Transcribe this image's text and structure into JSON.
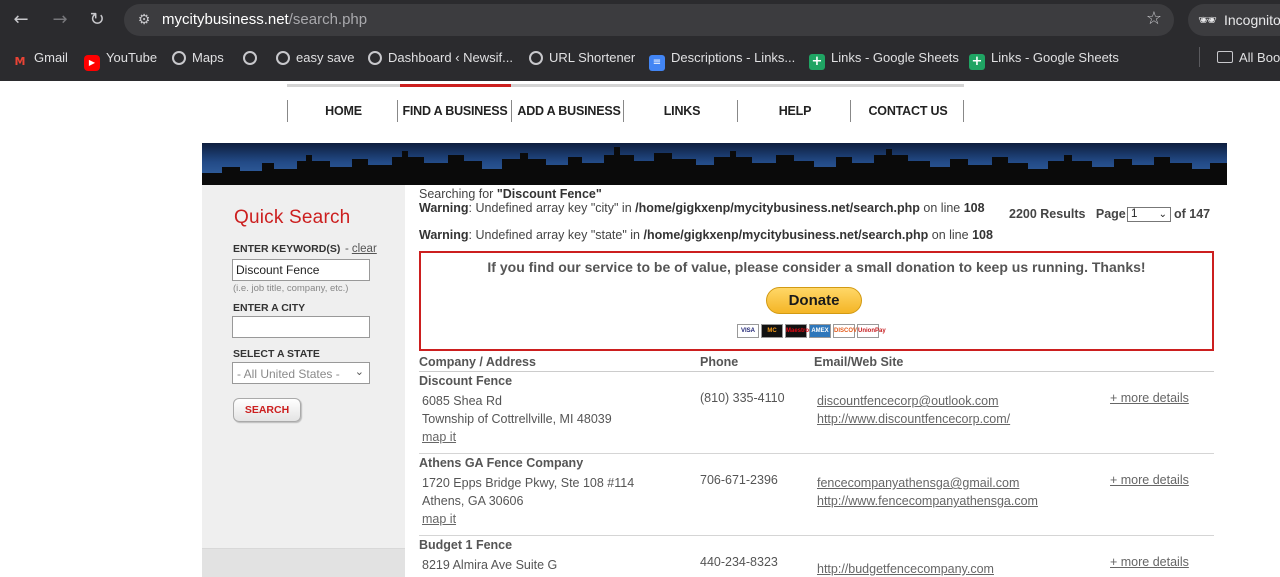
{
  "browser": {
    "url_domain": "mycitybusiness.net",
    "url_path": "/search.php",
    "profile_label": "Incognito",
    "bookmarks": [
      {
        "label": "Gmail",
        "icon": "gmail-icon"
      },
      {
        "label": "YouTube",
        "icon": "youtube-icon"
      },
      {
        "label": "Maps",
        "icon": "globe-icon"
      },
      {
        "label": "",
        "icon": "globe-icon"
      },
      {
        "label": "easy save",
        "icon": "globe-icon"
      },
      {
        "label": "Dashboard ‹ Newsif...",
        "icon": "globe-icon"
      },
      {
        "label": "URL Shortener",
        "icon": "globe-icon"
      },
      {
        "label": "Descriptions - Links...",
        "icon": "docs-icon"
      },
      {
        "label": "Links - Google Sheets",
        "icon": "sheets-icon"
      },
      {
        "label": "Links - Google Sheets",
        "icon": "sheets-icon"
      },
      {
        "label": "All Boo",
        "icon": "folder-icon"
      }
    ]
  },
  "site_nav": {
    "items": [
      "HOME",
      "FIND A BUSINESS",
      "ADD A BUSINESS",
      "LINKS",
      "HELP",
      "CONTACT US"
    ],
    "active": "FIND A BUSINESS"
  },
  "sidebar": {
    "title": "Quick Search",
    "keyword_label": "ENTER KEYWORD(S)",
    "clear_label": "clear",
    "clear_prefix": "-",
    "keyword_value": "Discount Fence",
    "keyword_hint": "(i.e. job title, company, etc.)",
    "city_label": "ENTER A CITY",
    "city_value": "",
    "state_label": "SELECT A STATE",
    "state_value": "- All United States -",
    "search_button": "SEARCH"
  },
  "results_header": {
    "searching_prefix": "Searching for",
    "search_term": "\"Discount Fence\"",
    "warnings": [
      {
        "label": "Warning",
        "text": ": Undefined array key \"city\" in ",
        "path": "/home/gigkxenp/mycitybusiness.net/search.php",
        "online": " on line ",
        "line": "108"
      },
      {
        "label": "Warning",
        "text": ": Undefined array key \"state\" in ",
        "path": "/home/gigkxenp/mycitybusiness.net/search.php",
        "online": " on line ",
        "line": "108"
      }
    ],
    "results_count": "2200 Results",
    "page_label": "Page:",
    "page_value": "1",
    "of_pages": "of 147"
  },
  "donation": {
    "message": "If you find our service to be of value, please consider a small donation to keep us running. Thanks!",
    "button_label": "Donate",
    "cards": [
      "VISA",
      "MC",
      "Maestro",
      "AMEX",
      "DISCOVER",
      "UnionPay"
    ]
  },
  "table": {
    "headers": [
      "Company / Address",
      "Phone",
      "Email/Web Site"
    ],
    "rows": [
      {
        "name": "Discount Fence",
        "address1": "6085 Shea Rd",
        "address2": "Township of Cottrellville, MI 48039",
        "map": "map it",
        "phone": "(810) 335-4110",
        "email": "discountfencecorp@outlook.com",
        "web": "http://www.discountfencecorp.com/",
        "more": "+ more details"
      },
      {
        "name": "Athens GA Fence Company",
        "address1": "1720 Epps Bridge Pkwy, Ste 108 #114",
        "address2": "Athens, GA 30606",
        "map": "map it",
        "phone": "706-671-2396",
        "email": "fencecompanyathensga@gmail.com",
        "web": "http://www.fencecompanyathensga.com",
        "more": "+ more details"
      },
      {
        "name": "Budget 1 Fence",
        "address1": "8219 Almira Ave Suite G",
        "address2": "",
        "map": "",
        "phone": "440-234-8323",
        "email": "",
        "web": "http://budgetfencecompany.com",
        "more": "+ more details"
      }
    ]
  },
  "colors": {
    "brand_red": "#cc1f1f",
    "chrome_bg": "#2b2b2e",
    "sidebar_bg": "#efefef"
  }
}
